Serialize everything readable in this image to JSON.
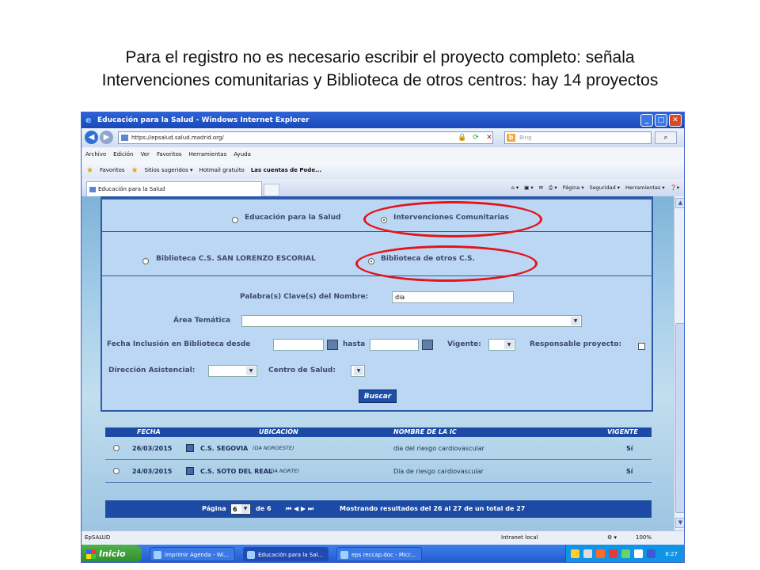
{
  "slide": {
    "title_line1": "Para el registro no es necesario escribir el proyecto completo: señala",
    "title_line2": "Intervenciones comunitarias y Biblioteca de otros centros: hay 14 proyectos"
  },
  "window": {
    "title": "Educación para la Salud - Windows Internet Explorer",
    "url": "https://epsalud.salud.madrid.org/",
    "search_placeholder": "Bing",
    "menu": [
      "Archivo",
      "Edición",
      "Ver",
      "Favoritos",
      "Herramientas",
      "Ayuda"
    ],
    "favorites": {
      "label": "Favoritos",
      "items": [
        "Sitios sugeridos ▾",
        "Hotmail gratuito",
        "Las cuentas de Pode..."
      ]
    },
    "tab_label": "Educación para la Salud",
    "commands": [
      "Página ▾",
      "Seguridad ▾",
      "Herramientas ▾"
    ]
  },
  "form": {
    "radio_eps": "Educación para la Salud",
    "radio_ic": "Intervenciones Comunitarias",
    "radio_biblio_sl": "Biblioteca C.S. SAN LORENZO ESCORIAL",
    "radio_biblio_otros": "Biblioteca de otros C.S.",
    "keywords_label": "Palabra(s) Clave(s) del Nombre:",
    "keywords_value": "dia",
    "area_label": "Área Temática",
    "fecha_label": "Fecha Inclusión en Biblioteca desde",
    "hasta_label": "hasta",
    "vigente_label": "Vigente:",
    "responsable_label": "Responsable proyecto:",
    "direccion_label": "Dirección Asistencial:",
    "centro_label": "Centro de Salud:",
    "buscar_label": "Buscar"
  },
  "results": {
    "headers": [
      "FECHA",
      "UBICACIÓN",
      "NOMBRE DE LA IC",
      "VIGENTE"
    ],
    "rows": [
      {
        "fecha": "26/03/2015",
        "centro": "C.S. SEGOVIA",
        "da": "(DA NOROESTE)",
        "nombre": "dia del riesgo cardiovascular",
        "vigente": "Sí"
      },
      {
        "fecha": "24/03/2015",
        "centro": "C.S. SOTO DEL REAL",
        "da": "(DA NORTE)",
        "nombre": "Dia de riesgo cardiovascular",
        "vigente": "Sí"
      }
    ],
    "pager": {
      "page_label": "Página",
      "page_value": "6",
      "of_label": "de 6",
      "nav": "⏮ ◀ ▶ ⏭",
      "summary": "Mostrando resultados del 26 al 27 de un total de 27"
    }
  },
  "statusbar": {
    "left": "EpSALUD",
    "zone": "Intranet local",
    "zoom": "100%"
  },
  "taskbar": {
    "start": "Inicio",
    "tasks": [
      "Imprimir Agenda - Wi...",
      "Educación para la Sal...",
      "eps reccap.doc - Micr..."
    ],
    "clock": "8:27"
  },
  "colors": {
    "highlight_oval": "#e3141b",
    "panel_border": "#2d5aa8",
    "header_blue": "#1c4aa4"
  }
}
